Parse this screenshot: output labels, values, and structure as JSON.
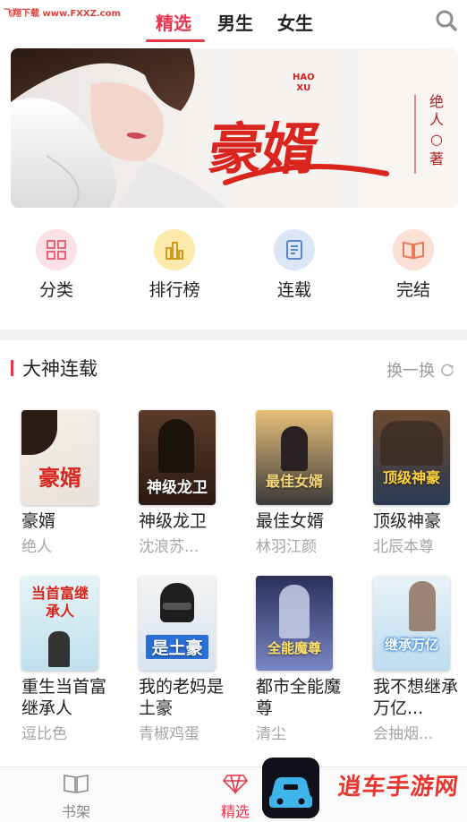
{
  "watermark_top": "飞翔下载 www.FXXZ.com",
  "tabs": [
    {
      "label": "精选",
      "active": true
    },
    {
      "label": "男生",
      "active": false
    },
    {
      "label": "女生",
      "active": false
    }
  ],
  "banner": {
    "title": "豪婿",
    "pinyin_line1": "HAO",
    "pinyin_line2": "XU",
    "author": "绝人",
    "author_suffix": "著",
    "slide_count": 3
  },
  "categories": [
    {
      "label": "分类",
      "icon": "grid-icon",
      "color": "#f7d6dc"
    },
    {
      "label": "排行榜",
      "icon": "bar-chart-icon",
      "color": "#fbe7a8"
    },
    {
      "label": "连载",
      "icon": "document-icon",
      "color": "#d8e6f7"
    },
    {
      "label": "完结",
      "icon": "open-book-icon",
      "color": "#fbdcd3"
    }
  ],
  "section": {
    "title": "大神连载",
    "refresh_label": "换一换"
  },
  "books": [
    {
      "title": "豪婿",
      "author": "绝人",
      "cover_text": "豪婿"
    },
    {
      "title": "神级龙卫",
      "author": "沈浪苏...",
      "cover_text": "神级龙卫"
    },
    {
      "title": "最佳女婿",
      "author": "林羽江颜",
      "cover_text": "最佳女婿"
    },
    {
      "title": "顶级神豪",
      "author": "北辰本尊",
      "cover_text": "顶级神豪"
    },
    {
      "title": "重生当首富继承人",
      "author": "逗比色",
      "cover_text": "当首富继承人"
    },
    {
      "title": "我的老妈是土豪",
      "author": "青椒鸡蛋",
      "cover_text": "是土豪"
    },
    {
      "title": "都市全能魔尊",
      "author": "清尘",
      "cover_text": "全能魔尊"
    },
    {
      "title": "我不想继承万亿...",
      "author": "会抽烟...",
      "cover_text": "继承万亿"
    }
  ],
  "bottom_nav": [
    {
      "label": "书架",
      "icon": "bookshelf-icon",
      "active": false
    },
    {
      "label": "精选",
      "icon": "diamond-icon",
      "active": true
    }
  ],
  "watermark_bottom": "逍车手游网"
}
